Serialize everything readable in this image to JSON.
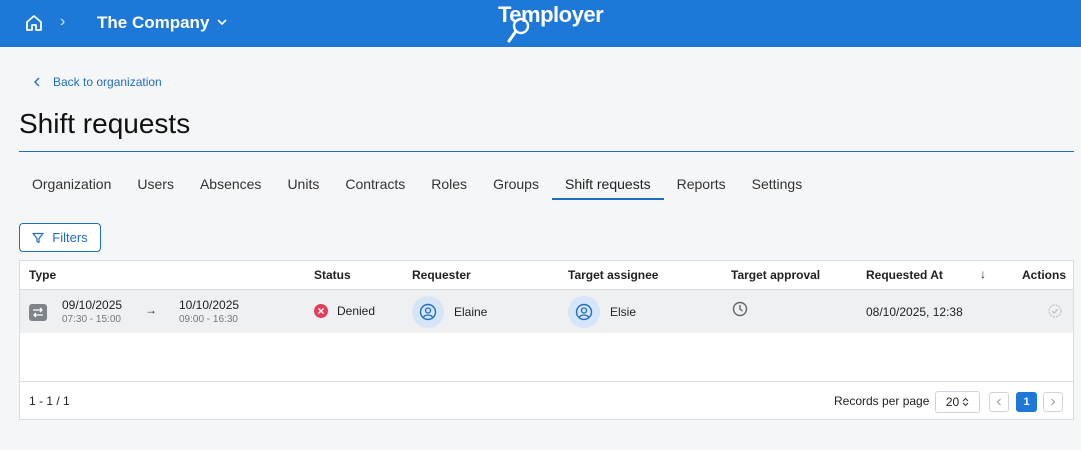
{
  "topbar": {
    "company": "The Company",
    "logo_text": "Temployer",
    "separator": "›"
  },
  "back_link": "Back to organization",
  "page_title": "Shift requests",
  "tabs": [
    {
      "label": "Organization",
      "active": false
    },
    {
      "label": "Users",
      "active": false
    },
    {
      "label": "Absences",
      "active": false
    },
    {
      "label": "Units",
      "active": false
    },
    {
      "label": "Contracts",
      "active": false
    },
    {
      "label": "Roles",
      "active": false
    },
    {
      "label": "Groups",
      "active": false
    },
    {
      "label": "Shift requests",
      "active": true
    },
    {
      "label": "Reports",
      "active": false
    },
    {
      "label": "Settings",
      "active": false
    }
  ],
  "filters_label": "Filters",
  "table": {
    "columns": {
      "type": "Type",
      "status": "Status",
      "requester": "Requester",
      "target_assignee": "Target assignee",
      "target_approval": "Target approval",
      "requested_at": "Requested At",
      "actions": "Actions"
    },
    "sort_indicator": "↓",
    "rows": [
      {
        "from_date": "09/10/2025",
        "from_time": "07:30 - 15:00",
        "arrow": "→",
        "to_date": "10/10/2025",
        "to_time": "09:00 - 16:30",
        "status": "Denied",
        "requester": "Elaine",
        "target_assignee": "Elsie",
        "requested_at": "08/10/2025, 12:38"
      }
    ]
  },
  "footer": {
    "range": "1 - 1 / 1",
    "records_per_page_label": "Records per page",
    "records_per_page": "20",
    "current_page": "1"
  },
  "colors": {
    "accent": "#1e78d8",
    "denied": "#e2405a"
  }
}
